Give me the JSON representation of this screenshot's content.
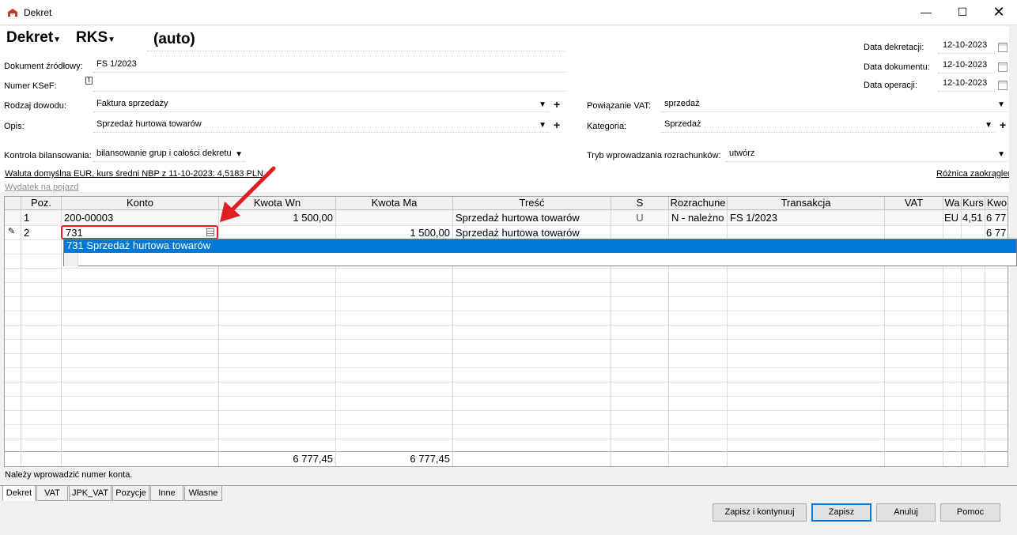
{
  "window": {
    "title": "Dekret",
    "minimize": "—",
    "maximize": "☐",
    "close": "✕"
  },
  "header": {
    "doc_type": "Dekret",
    "journal": "RKS",
    "number": "(auto)"
  },
  "fields": {
    "dokument_zrodlowy_label": "Dokument źródłowy:",
    "dokument_zrodlowy": "FS 1/2023",
    "numer_ksef_label": "Numer KSeF:",
    "rodzaj_dowodu_label": "Rodzaj dowodu:",
    "rodzaj_dowodu": "Faktura sprzedaży",
    "opis_label": "Opis:",
    "opis": "Sprzedaż hurtowa towarów",
    "kontrola_label": "Kontrola bilansowania:",
    "kontrola": "bilansowanie grup i całości dekretu",
    "powiazanie_vat_label": "Powiązanie VAT:",
    "powiazanie_vat": "sprzedaż",
    "kategoria_label": "Kategoria:",
    "kategoria": "Sprzedaż",
    "tryb_label": "Tryb wprowadzania rozrachunków:",
    "tryb": "utwórz",
    "data_dekretacji_label": "Data dekretacji:",
    "data_dekretacji": "12-10-2023",
    "data_dokumentu_label": "Data dokumentu:",
    "data_dokumentu": "12-10-2023",
    "data_operacji_label": "Data operacji:",
    "data_operacji": "12-10-2023"
  },
  "links": {
    "waluta": "Waluta domyślna EUR, kurs średni NBP z 11-10-2023: 4,5183 PLN",
    "wydatek": "Wydatek na pojazd",
    "roznica": "Różnica zaokrągleń"
  },
  "grid": {
    "columns": [
      "Poz.",
      "Konto",
      "Kwota Wn",
      "Kwota Ma",
      "Treść",
      "S",
      "Rozrachune",
      "Transakcja",
      "VAT",
      "Wa",
      "Kurs",
      "Kwo"
    ],
    "rows": [
      {
        "poz": "1",
        "konto": "200-00003",
        "wn": "1 500,00",
        "ma": "",
        "tresc": "Sprzedaż hurtowa towarów",
        "s": "U",
        "rozrach": "N - należno",
        "transakcja": "FS 1/2023",
        "vat": "",
        "wa": "EU",
        "kurs": "4,51",
        "kwo": "6 77"
      },
      {
        "poz": "2",
        "konto": "731",
        "wn": "",
        "ma": "1 500,00",
        "tresc": "Sprzedaż hurtowa towarów",
        "s": "",
        "rozrach": "",
        "transakcja": "",
        "vat": "",
        "wa": "",
        "kurs": "",
        "kwo": "6 77"
      }
    ],
    "dropdown_item": "731 Sprzedaż hurtowa towarów",
    "sum_wn": "6 777,45",
    "sum_ma": "6 777,45"
  },
  "status": "Należy wprowadzić numer konta.",
  "tabs": [
    "Dekret",
    "VAT",
    "JPK_VAT",
    "Pozycje",
    "Inne",
    "Własne"
  ],
  "buttons": {
    "zapisz_kontynuuj": "Zapisz i kontynuuj",
    "zapisz": "Zapisz",
    "anuluj": "Anuluj",
    "pomoc": "Pomoc"
  },
  "icons": {
    "dropdown": "▼",
    "add": "+",
    "info": "!",
    "edit": "✎"
  },
  "colors": {
    "selection": "#0078d7",
    "annotation": "#e02020"
  }
}
